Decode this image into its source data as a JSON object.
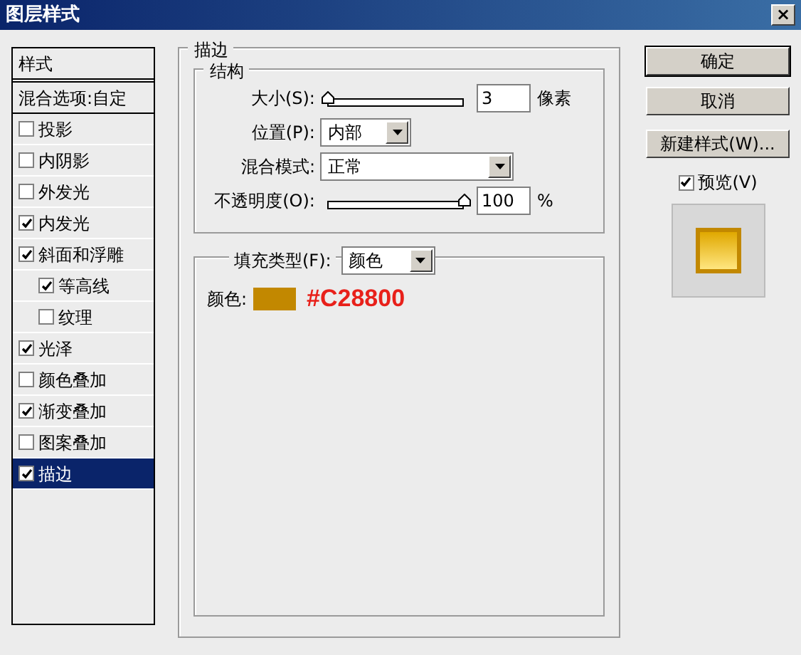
{
  "window": {
    "title": "图层样式",
    "close": "×"
  },
  "sidebar": {
    "header": "样式",
    "blend_options": "混合选项:自定",
    "items": [
      {
        "label": "投影",
        "checked": false,
        "selected": false
      },
      {
        "label": "内阴影",
        "checked": false,
        "selected": false
      },
      {
        "label": "外发光",
        "checked": false,
        "selected": false
      },
      {
        "label": "内发光",
        "checked": true,
        "selected": false
      },
      {
        "label": "斜面和浮雕",
        "checked": true,
        "selected": false,
        "children": [
          {
            "label": "等高线",
            "checked": true,
            "selected": false
          },
          {
            "label": "纹理",
            "checked": false,
            "selected": false
          }
        ]
      },
      {
        "label": "光泽",
        "checked": true,
        "selected": false
      },
      {
        "label": "颜色叠加",
        "checked": false,
        "selected": false
      },
      {
        "label": "渐变叠加",
        "checked": true,
        "selected": false
      },
      {
        "label": "图案叠加",
        "checked": false,
        "selected": false
      },
      {
        "label": "描边",
        "checked": true,
        "selected": true
      }
    ]
  },
  "stroke": {
    "title": "描边",
    "structure": {
      "title": "结构",
      "size": {
        "label": "大小(S):",
        "level": 0.0,
        "value": "3",
        "unit": "像素"
      },
      "position": {
        "label": "位置(P):",
        "value": "内部"
      },
      "blend_mode": {
        "label": "混合模式:",
        "value": "正常"
      },
      "opacity": {
        "label": "不透明度(O):",
        "level": 1.0,
        "value": "100",
        "unit": "%"
      }
    },
    "fill": {
      "label": "填充类型(F):",
      "value": "颜色",
      "color_label": "颜色:",
      "color": "#c28800",
      "annotation": "#C28800"
    }
  },
  "buttons": [
    {
      "label": "确定",
      "default": true
    },
    {
      "label": "取消",
      "default": false
    },
    {
      "label": "新建样式(W)...",
      "default": false
    }
  ],
  "preview": {
    "label": "预览(V)",
    "checked": true
  }
}
